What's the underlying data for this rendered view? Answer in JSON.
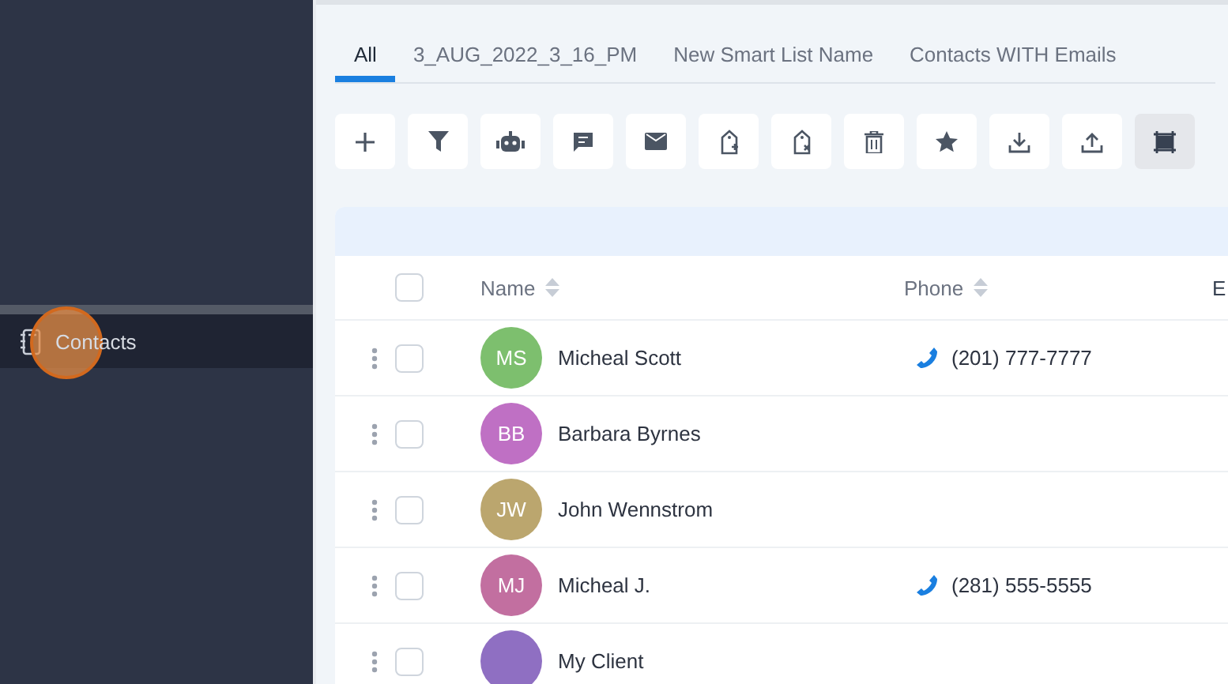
{
  "sidebar": {
    "items": [
      {
        "label": "Contacts",
        "selected": true,
        "highlighted": true
      }
    ]
  },
  "tabs": [
    {
      "label": "All",
      "selected": true
    },
    {
      "label": "3_AUG_2022_3_16_PM",
      "selected": false
    },
    {
      "label": "New Smart List Name",
      "selected": false
    },
    {
      "label": "Contacts WITH Emails",
      "selected": false
    }
  ],
  "toolbar": [
    {
      "kind": "plus",
      "selected": false
    },
    {
      "kind": "filter",
      "selected": false
    },
    {
      "kind": "robot",
      "selected": false
    },
    {
      "kind": "chat",
      "selected": false
    },
    {
      "kind": "mail",
      "selected": false
    },
    {
      "kind": "tag-add",
      "selected": false
    },
    {
      "kind": "tag-remove",
      "selected": false
    },
    {
      "kind": "trash",
      "selected": false
    },
    {
      "kind": "star",
      "selected": false
    },
    {
      "kind": "download",
      "selected": false
    },
    {
      "kind": "upload",
      "selected": false
    },
    {
      "kind": "columns",
      "selected": true
    }
  ],
  "table": {
    "select_all": {
      "checked": false
    },
    "columns": [
      {
        "label": "Name",
        "sortable": true
      },
      {
        "label": "Phone",
        "sortable": true
      },
      {
        "label": "E"
      }
    ],
    "rows": [
      {
        "initials": "MS",
        "color": "#7dbf6e",
        "name": "Micheal Scott",
        "phone": "(201) 777-7777",
        "checked": false
      },
      {
        "initials": "BB",
        "color": "#bf70c4",
        "name": "Barbara Byrnes",
        "checked": false
      },
      {
        "initials": "JW",
        "color": "#bba66e",
        "name": "John Wennstrom",
        "checked": false
      },
      {
        "initials": "MJ",
        "color": "#c26fa0",
        "name": "Micheal J.",
        "phone": "(281) 555-5555",
        "checked": false
      },
      {
        "color": "#8f6fc2",
        "name": "My Client",
        "checked": false
      }
    ]
  }
}
